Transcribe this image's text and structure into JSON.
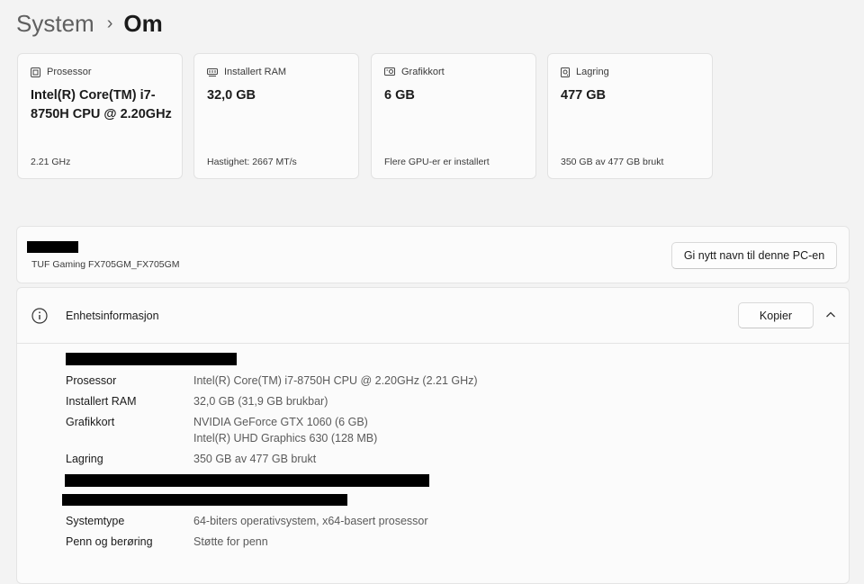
{
  "breadcrumb": {
    "parent": "System",
    "separator": "›",
    "current": "Om"
  },
  "cards": [
    {
      "icon": "processor-icon",
      "label": "Prosessor",
      "value": "Intel(R) Core(TM) i7-8750H CPU @ 2.20GHz",
      "sub": "2.21 GHz"
    },
    {
      "icon": "ram-icon",
      "label": "Installert RAM",
      "value": "32,0 GB",
      "sub": "Hastighet: 2667 MT/s"
    },
    {
      "icon": "graphics-card-icon",
      "label": "Grafikkort",
      "value": "6 GB",
      "sub": "Flere GPU-er er installert"
    },
    {
      "icon": "storage-icon",
      "label": "Lagring",
      "value": "477 GB",
      "sub": "350 GB av 477 GB brukt"
    }
  ],
  "device": {
    "model": "TUF Gaming FX705GM_FX705GM",
    "rename_button": "Gi nytt navn til denne PC-en"
  },
  "device_info": {
    "title": "Enhetsinformasjon",
    "copy_button": "Kopier",
    "specs": [
      {
        "label": "Prosessor",
        "value": "Intel(R) Core(TM) i7-8750H CPU @ 2.20GHz (2.21 GHz)"
      },
      {
        "label": "Installert RAM",
        "value": "32,0 GB (31,9 GB brukbar)"
      },
      {
        "label": "Grafikkort",
        "value": "NVIDIA GeForce GTX 1060 (6 GB)",
        "value2": "Intel(R) UHD Graphics 630 (128 MB)"
      },
      {
        "label": "Lagring",
        "value": "350 GB av 477 GB brukt"
      },
      {
        "label": "Systemtype",
        "value": "64-biters operativsystem, x64-basert prosessor"
      },
      {
        "label": "Penn og berøring",
        "value": "Støtte for penn"
      }
    ]
  },
  "colors": {
    "background": "#f3f3f3",
    "card": "#fbfbfb",
    "redaction": "#000000"
  }
}
